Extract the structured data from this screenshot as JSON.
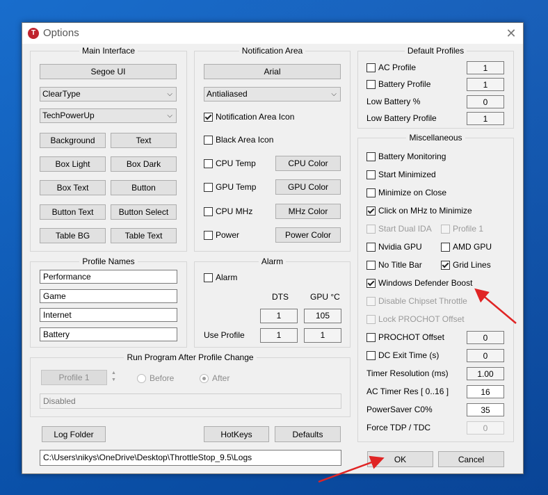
{
  "window": {
    "title": "Options",
    "icon_letter": "T"
  },
  "main_interface": {
    "title": "Main Interface",
    "font_button": "Segoe UI",
    "render_select": "ClearType",
    "theme_select": "TechPowerUp",
    "color_buttons": [
      "Background",
      "Text",
      "Box Light",
      "Box Dark",
      "Box Text",
      "Button",
      "Button Text",
      "Button Select",
      "Table BG",
      "Table Text"
    ]
  },
  "notification_area": {
    "title": "Notification Area",
    "font_button": "Arial",
    "render_select": "Antialiased",
    "notification_icon": {
      "label": "Notification Area Icon",
      "checked": true
    },
    "black_icon": {
      "label": "Black Area Icon",
      "checked": false
    },
    "rows": [
      {
        "check": "CPU Temp",
        "button": "CPU Color"
      },
      {
        "check": "GPU Temp",
        "button": "GPU Color"
      },
      {
        "check": "CPU MHz",
        "button": "MHz Color"
      },
      {
        "check": "Power",
        "button": "Power Color"
      }
    ]
  },
  "default_profiles": {
    "title": "Default Profiles",
    "ac_profile": {
      "label": "AC Profile",
      "value": "1"
    },
    "battery_profile": {
      "label": "Battery Profile",
      "value": "1"
    },
    "low_battery_pct": {
      "label": "Low Battery %",
      "value": "0"
    },
    "low_battery_profile": {
      "label": "Low Battery Profile",
      "value": "1"
    }
  },
  "misc": {
    "title": "Miscellaneous",
    "battery_monitoring": "Battery Monitoring",
    "start_minimized": "Start Minimized",
    "minimize_on_close": "Minimize on Close",
    "click_mhz": "Click on MHz to Minimize",
    "start_dual_ida": "Start Dual IDA",
    "profile_1": "Profile 1",
    "nvidia_gpu": "Nvidia GPU",
    "amd_gpu": "AMD GPU",
    "no_title_bar": "No Title Bar",
    "grid_lines": "Grid Lines",
    "defender_boost": "Windows Defender Boost",
    "disable_chipset": "Disable Chipset Throttle",
    "lock_prochot": "Lock PROCHOT Offset",
    "prochot_offset": {
      "label": "PROCHOT Offset",
      "value": "0"
    },
    "dc_exit_time": {
      "label": "DC Exit Time (s)",
      "value": "0"
    },
    "timer_resolution": {
      "label": "Timer Resolution (ms)",
      "value": "1.00"
    },
    "ac_timer_res": {
      "label": "AC Timer Res [ 0..16 ]",
      "value": "16"
    },
    "powersaver": {
      "label": "PowerSaver C0%",
      "value": "35"
    },
    "force_tdp": {
      "label": "Force TDP / TDC",
      "value": "0"
    }
  },
  "profile_names": {
    "title": "Profile Names",
    "names": [
      "Performance",
      "Game",
      "Internet",
      "Battery"
    ]
  },
  "alarm": {
    "title": "Alarm",
    "alarm_label": "Alarm",
    "dts_header": "DTS",
    "gpu_header": "GPU °C",
    "dts_value": "1",
    "gpu_value": "105",
    "use_profile_label": "Use Profile",
    "dts_profile": "1",
    "gpu_profile": "1"
  },
  "run_program": {
    "title": "Run Program After Profile Change",
    "profile_button": "Profile 1",
    "before_label": "Before",
    "after_label": "After",
    "program_field": "Disabled"
  },
  "footer": {
    "log_folder": "Log Folder",
    "hotkeys": "HotKeys",
    "defaults": "Defaults",
    "log_path": "C:\\Users\\nikys\\OneDrive\\Desktop\\ThrottleStop_9.5\\Logs",
    "ok": "OK",
    "cancel": "Cancel"
  },
  "colors": {
    "annotation_arrow": "#e02424",
    "app_icon": "#c0242e"
  }
}
